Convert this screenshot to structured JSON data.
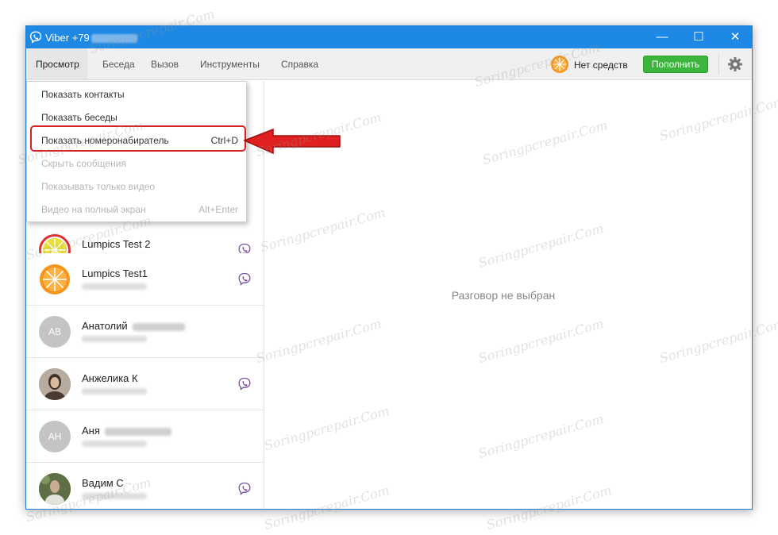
{
  "window": {
    "title_prefix": "Viber +79",
    "controls": {
      "minimize": "—",
      "maximize": "☐",
      "close": "✕"
    }
  },
  "menubar": {
    "items": [
      "Просмотр",
      "Беседа",
      "Вызов",
      "Инструменты",
      "Справка"
    ],
    "active_index": 0,
    "balance_text": "Нет средств",
    "topup_label": "Пополнить",
    "settings_icon": "gear-icon"
  },
  "dropdown": {
    "items": [
      {
        "label": "Показать контакты",
        "shortcut": "",
        "enabled": true
      },
      {
        "label": "Показать беседы",
        "shortcut": "",
        "enabled": true
      },
      {
        "label": "Показать номеронабиратель",
        "shortcut": "Ctrl+D",
        "enabled": true,
        "highlighted": true
      },
      {
        "label": "Скрыть сообщения",
        "shortcut": "",
        "enabled": false
      },
      {
        "label": "Показывать только видео",
        "shortcut": "",
        "enabled": false
      },
      {
        "label": "Видео на полный экран",
        "shortcut": "Alt+Enter",
        "enabled": false
      }
    ]
  },
  "contacts": [
    {
      "name": "Lumpics Test 2",
      "avatar": "lemon",
      "viber": true
    },
    {
      "name": "Lumpics Test1",
      "avatar": "orange",
      "viber": true
    },
    {
      "name": "Анатолий",
      "avatar_initials": "АВ",
      "viber": false
    },
    {
      "name": "Анжелика К",
      "avatar": "photo",
      "viber": true
    },
    {
      "name": "Аня",
      "avatar_initials": "АН",
      "viber": false
    },
    {
      "name": "Вадим С",
      "avatar": "photo",
      "viber": true
    }
  ],
  "main": {
    "empty_state": "Разговор не выбран"
  },
  "watermark": "Soringpcrepair.Com",
  "colors": {
    "titlebar": "#1e88e5",
    "topup": "#3bb53b",
    "highlight": "#d32222",
    "viber_purple": "#7b519d"
  }
}
